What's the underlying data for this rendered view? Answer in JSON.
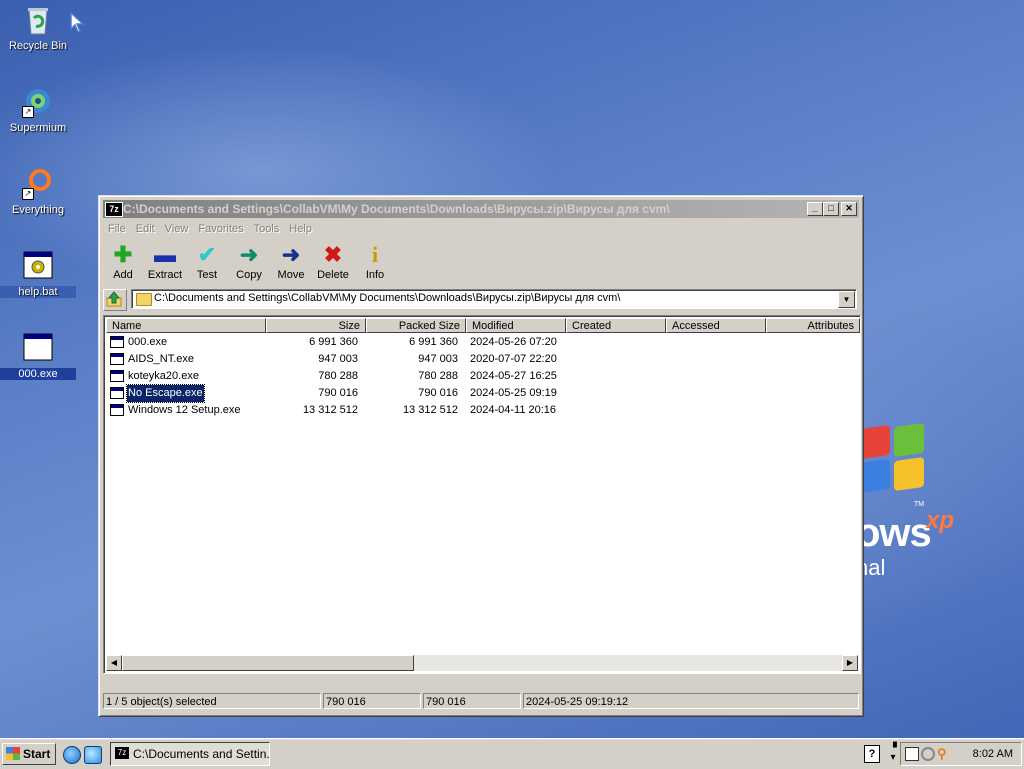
{
  "desktop": {
    "icons": [
      {
        "label": "Recycle Bin"
      },
      {
        "label": "Supermium"
      },
      {
        "label": "Everything"
      },
      {
        "label": "help.bat"
      },
      {
        "label": "000.exe"
      }
    ],
    "wallpaper_logo": {
      "text": "ows",
      "superscript": "xp",
      "sub": "nal",
      "tm": "TM"
    }
  },
  "window": {
    "title": "C:\\Documents and Settings\\CollabVM\\My Documents\\Downloads\\Вирусы.zip\\Вирусы для cvm\\",
    "app_icon": "7z",
    "controls": {
      "minimize": "_",
      "maximize": "□",
      "close": "✕"
    },
    "menu": [
      "File",
      "Edit",
      "View",
      "Favorites",
      "Tools",
      "Help"
    ],
    "toolbar": [
      {
        "label": "Add",
        "icon": "plus-icon",
        "glyph": "✚",
        "color": "#21a621"
      },
      {
        "label": "Extract",
        "icon": "minus-icon",
        "glyph": "▬",
        "color": "#1b2fa6"
      },
      {
        "label": "Test",
        "icon": "check-icon",
        "glyph": "✔",
        "color": "#2ec9c9"
      },
      {
        "label": "Copy",
        "icon": "copy-arrow-icon",
        "glyph": "➜",
        "color": "#0f8c6a"
      },
      {
        "label": "Move",
        "icon": "move-arrow-icon",
        "glyph": "➜",
        "color": "#1b2f8c"
      },
      {
        "label": "Delete",
        "icon": "delete-x-icon",
        "glyph": "✖",
        "color": "#d01818"
      },
      {
        "label": "Info",
        "icon": "info-icon",
        "glyph": "i",
        "color": "#c79b00"
      }
    ],
    "address": "C:\\Documents and Settings\\CollabVM\\My Documents\\Downloads\\Вирусы.zip\\Вирусы для cvm\\",
    "columns": [
      "Name",
      "Size",
      "Packed Size",
      "Modified",
      "Created",
      "Accessed",
      "Attributes"
    ],
    "files": [
      {
        "name": "000.exe",
        "size": "6 991 360",
        "packed": "6 991 360",
        "modified": "2024-05-26 07:20",
        "selected": false
      },
      {
        "name": "AIDS_NT.exe",
        "size": "947 003",
        "packed": "947 003",
        "modified": "2020-07-07 22:20",
        "selected": false
      },
      {
        "name": "koteyka20.exe",
        "size": "780 288",
        "packed": "780 288",
        "modified": "2024-05-27 16:25",
        "selected": false
      },
      {
        "name": "No Escape.exe",
        "size": "790 016",
        "packed": "790 016",
        "modified": "2024-05-25 09:19",
        "selected": true
      },
      {
        "name": "Windows 12 Setup.exe",
        "size": "13 312 512",
        "packed": "13 312 512",
        "modified": "2024-04-11 20:16",
        "selected": false
      }
    ],
    "status": {
      "selection": "1 / 5 object(s) selected",
      "size": "790 016",
      "packed": "790 016",
      "modified": "2024-05-25 09:19:12"
    }
  },
  "taskbar": {
    "start_label": "Start",
    "task_label": "C:\\Documents and Settin...",
    "task_icon": "7z",
    "help_icon": "?",
    "clock": "8:02 AM"
  }
}
